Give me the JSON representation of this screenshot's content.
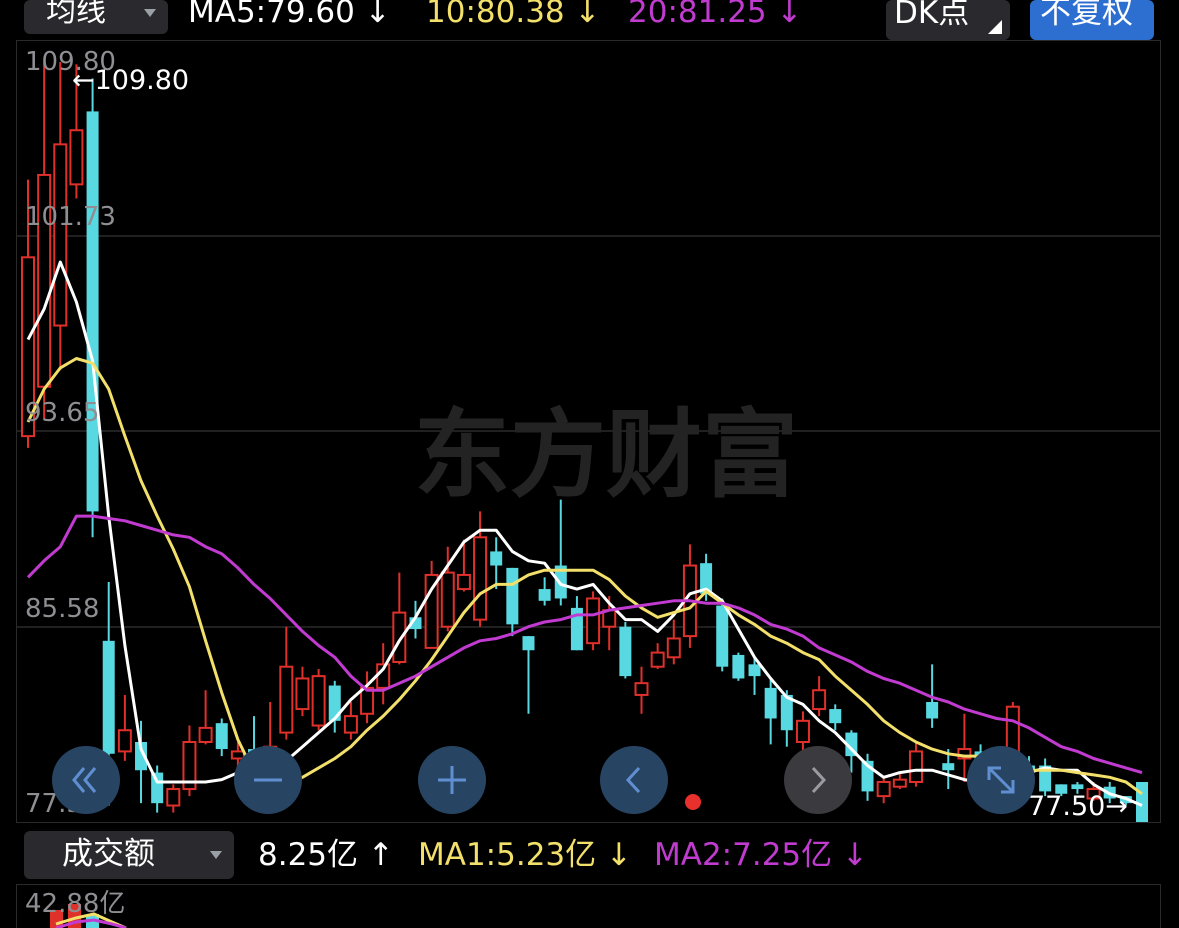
{
  "top": {
    "period_label": "均线",
    "ma5": "MA5:79.60",
    "ma10": "10:80.38",
    "ma20": "20:81.25",
    "arrow_down": "↓",
    "dk_label": "DK点",
    "fq_label": "不复权"
  },
  "y_axis": {
    "l1": "109.80",
    "l2": "101.73",
    "l3": "93.65",
    "l4": "85.58",
    "l5": "77.50"
  },
  "markers": {
    "high": "109.80",
    "low": "77.50"
  },
  "watermark": "东方财富",
  "volume": {
    "label": "成交额",
    "value": "8.25亿",
    "value_arrow": "↑",
    "ma1": "MA1:5.23亿",
    "ma1_arrow": "↓",
    "ma2": "MA2:7.25亿",
    "ma2_arrow": "↓",
    "y_top": "42.88亿"
  },
  "colors": {
    "up": "#e0302a",
    "down": "#58d8e0",
    "ma5": "#ffffff",
    "ma10": "#f2e06a",
    "ma20": "#c23bd1",
    "accent": "#2d6fd0"
  },
  "chart_data": {
    "type": "candlestick",
    "y_range": [
      77.5,
      109.8
    ],
    "series": [
      {
        "name": "MA5",
        "values": [
          98.0,
          99.3,
          101.3,
          99.6,
          97.1,
          90.5,
          85.0,
          80.6,
          79.2,
          79.2,
          79.2,
          79.2,
          79.3,
          79.6,
          79.5,
          79.6,
          80.1,
          80.7,
          81.3,
          81.9,
          82.7,
          83.3,
          84.0,
          85.2,
          86.2,
          87.4,
          88.4,
          89.4,
          89.9,
          89.9,
          89.0,
          88.6,
          88.5,
          87.6,
          87.4,
          87.6,
          86.8,
          86.1,
          86.1,
          85.6,
          86.3,
          87.2,
          87.4,
          86.9,
          85.7,
          84.5,
          83.6,
          82.8,
          82.5,
          81.8,
          81.3,
          80.6,
          79.9,
          79.4,
          79.6,
          79.7,
          79.7,
          79.5,
          79.3,
          79.2,
          79.2,
          79.1,
          79.6,
          79.8,
          79.7,
          79.7,
          79.1,
          78.7,
          78.5,
          78.2
        ]
      },
      {
        "name": "MA10",
        "values": [
          94.5,
          95.9,
          96.8,
          97.2,
          97.0,
          95.9,
          93.9,
          92.0,
          90.5,
          89.1,
          87.5,
          85.2,
          83.0,
          81.0,
          79.6,
          79.3,
          79.3,
          79.4,
          79.8,
          80.2,
          80.7,
          81.4,
          82.0,
          82.7,
          83.5,
          84.4,
          85.4,
          86.4,
          87.2,
          87.6,
          87.6,
          88.0,
          88.2,
          88.2,
          88.2,
          88.2,
          87.8,
          87.1,
          86.6,
          86.2,
          86.4,
          86.6,
          87.3,
          86.8,
          86.3,
          85.9,
          85.4,
          85.1,
          84.7,
          84.4,
          83.7,
          83.1,
          82.5,
          81.8,
          81.3,
          80.9,
          80.6,
          80.4,
          80.3,
          80.3,
          80.0,
          79.6,
          79.7,
          79.7,
          79.7,
          79.6,
          79.5,
          79.4,
          79.2,
          78.7
        ]
      },
      {
        "name": "MA20",
        "values": [
          87.9,
          88.6,
          89.2,
          90.5,
          90.5,
          90.4,
          90.3,
          90.1,
          89.9,
          89.7,
          89.6,
          89.2,
          88.9,
          88.3,
          87.6,
          87.0,
          86.3,
          85.6,
          85.0,
          84.5,
          83.7,
          83.1,
          83.1,
          83.4,
          83.7,
          84.1,
          84.5,
          84.9,
          85.2,
          85.3,
          85.5,
          85.8,
          86.0,
          86.1,
          86.3,
          86.3,
          86.5,
          86.6,
          86.7,
          86.8,
          86.9,
          86.9,
          86.8,
          86.8,
          86.6,
          86.3,
          85.9,
          85.7,
          85.4,
          84.9,
          84.6,
          84.3,
          83.9,
          83.6,
          83.4,
          83.1,
          82.8,
          82.6,
          82.3,
          82.1,
          81.9,
          81.8,
          81.5,
          81.1,
          80.7,
          80.5,
          80.2,
          80.0,
          79.8,
          79.6
        ]
      }
    ],
    "candles": [
      {
        "o": 93.9,
        "c": 101.5,
        "h": 104.8,
        "l": 93.4,
        "up": true
      },
      {
        "o": 96.0,
        "c": 105.0,
        "h": 109.8,
        "l": 94.6,
        "up": true
      },
      {
        "o": 98.6,
        "c": 106.3,
        "h": 109.8,
        "l": 96.7,
        "up": true
      },
      {
        "o": 104.6,
        "c": 106.9,
        "h": 109.7,
        "l": 104.0,
        "up": true
      },
      {
        "o": 107.7,
        "c": 90.7,
        "h": 109.1,
        "l": 89.6,
        "up": false
      },
      {
        "o": 85.2,
        "c": 80.4,
        "h": 87.7,
        "l": 78.2,
        "up": false
      },
      {
        "o": 80.5,
        "c": 81.4,
        "h": 82.9,
        "l": 80.1,
        "up": true
      },
      {
        "o": 80.9,
        "c": 79.7,
        "h": 81.8,
        "l": 78.3,
        "up": false
      },
      {
        "o": 79.6,
        "c": 78.3,
        "h": 79.9,
        "l": 77.9,
        "up": false
      },
      {
        "o": 78.2,
        "c": 78.9,
        "h": 79.1,
        "l": 77.9,
        "up": true
      },
      {
        "o": 78.9,
        "c": 80.9,
        "h": 81.6,
        "l": 78.6,
        "up": true
      },
      {
        "o": 80.9,
        "c": 81.5,
        "h": 83.1,
        "l": 80.8,
        "up": true
      },
      {
        "o": 81.7,
        "c": 80.6,
        "h": 81.9,
        "l": 80.3,
        "up": false
      },
      {
        "o": 80.2,
        "c": 80.5,
        "h": 80.9,
        "l": 79.0,
        "up": true
      },
      {
        "o": 80.6,
        "c": 80.2,
        "h": 82.0,
        "l": 80.0,
        "up": false
      },
      {
        "o": 80.2,
        "c": 80.7,
        "h": 82.6,
        "l": 79.9,
        "up": true
      },
      {
        "o": 81.3,
        "c": 84.1,
        "h": 85.8,
        "l": 81.0,
        "up": true
      },
      {
        "o": 82.3,
        "c": 83.6,
        "h": 84.1,
        "l": 82.0,
        "up": true
      },
      {
        "o": 81.6,
        "c": 83.7,
        "h": 84.0,
        "l": 81.4,
        "up": true
      },
      {
        "o": 83.3,
        "c": 81.8,
        "h": 83.5,
        "l": 81.3,
        "up": false
      },
      {
        "o": 81.3,
        "c": 82.0,
        "h": 82.6,
        "l": 81.0,
        "up": true
      },
      {
        "o": 82.1,
        "c": 83.2,
        "h": 83.9,
        "l": 81.7,
        "up": true
      },
      {
        "o": 83.2,
        "c": 84.2,
        "h": 85.1,
        "l": 82.5,
        "up": true
      },
      {
        "o": 84.3,
        "c": 86.4,
        "h": 88.1,
        "l": 84.2,
        "up": true
      },
      {
        "o": 86.2,
        "c": 85.7,
        "h": 86.9,
        "l": 85.3,
        "up": false
      },
      {
        "o": 84.9,
        "c": 88.0,
        "h": 88.6,
        "l": 84.9,
        "up": true
      },
      {
        "o": 85.8,
        "c": 88.1,
        "h": 89.2,
        "l": 85.6,
        "up": true
      },
      {
        "o": 87.4,
        "c": 88.0,
        "h": 89.5,
        "l": 87.3,
        "up": true
      },
      {
        "o": 86.1,
        "c": 89.6,
        "h": 90.7,
        "l": 85.8,
        "up": true
      },
      {
        "o": 89.0,
        "c": 88.4,
        "h": 89.6,
        "l": 87.4,
        "up": false
      },
      {
        "o": 88.3,
        "c": 85.9,
        "h": 88.3,
        "l": 85.4,
        "up": false
      },
      {
        "o": 85.4,
        "c": 84.8,
        "h": 85.4,
        "l": 82.1,
        "up": false
      },
      {
        "o": 87.4,
        "c": 86.9,
        "h": 87.9,
        "l": 86.7,
        "up": false
      },
      {
        "o": 88.4,
        "c": 87.0,
        "h": 91.2,
        "l": 86.7,
        "up": false
      },
      {
        "o": 86.6,
        "c": 84.8,
        "h": 87.1,
        "l": 84.8,
        "up": false
      },
      {
        "o": 85.1,
        "c": 87.0,
        "h": 87.3,
        "l": 84.8,
        "up": true
      },
      {
        "o": 85.8,
        "c": 86.5,
        "h": 87.1,
        "l": 84.8,
        "up": true
      },
      {
        "o": 85.8,
        "c": 83.7,
        "h": 86.0,
        "l": 83.6,
        "up": false
      },
      {
        "o": 82.9,
        "c": 83.4,
        "h": 84.1,
        "l": 82.1,
        "up": true
      },
      {
        "o": 84.1,
        "c": 84.7,
        "h": 85.1,
        "l": 84.0,
        "up": true
      },
      {
        "o": 84.5,
        "c": 85.3,
        "h": 86.1,
        "l": 84.2,
        "up": true
      },
      {
        "o": 85.4,
        "c": 88.4,
        "h": 89.3,
        "l": 84.9,
        "up": true
      },
      {
        "o": 88.5,
        "c": 87.2,
        "h": 88.9,
        "l": 86.9,
        "up": false
      },
      {
        "o": 86.7,
        "c": 84.1,
        "h": 87.0,
        "l": 83.9,
        "up": false
      },
      {
        "o": 84.6,
        "c": 83.6,
        "h": 84.7,
        "l": 83.5,
        "up": false
      },
      {
        "o": 84.2,
        "c": 83.7,
        "h": 84.5,
        "l": 82.9,
        "up": false
      },
      {
        "o": 83.2,
        "c": 81.9,
        "h": 83.6,
        "l": 80.8,
        "up": false
      },
      {
        "o": 82.9,
        "c": 81.4,
        "h": 83.1,
        "l": 80.7,
        "up": false
      },
      {
        "o": 80.9,
        "c": 81.8,
        "h": 82.2,
        "l": 80.1,
        "up": true
      },
      {
        "o": 82.3,
        "c": 83.1,
        "h": 83.7,
        "l": 82.0,
        "up": true
      },
      {
        "o": 82.3,
        "c": 81.7,
        "h": 82.5,
        "l": 81.4,
        "up": false
      },
      {
        "o": 81.3,
        "c": 80.3,
        "h": 81.4,
        "l": 79.6,
        "up": false
      },
      {
        "o": 80.1,
        "c": 78.8,
        "h": 80.4,
        "l": 78.4,
        "up": false
      },
      {
        "o": 78.6,
        "c": 79.2,
        "h": 79.4,
        "l": 78.3,
        "up": true
      },
      {
        "o": 79.0,
        "c": 79.3,
        "h": 79.6,
        "l": 78.9,
        "up": true
      },
      {
        "o": 79.2,
        "c": 80.5,
        "h": 80.9,
        "l": 79.0,
        "up": true
      },
      {
        "o": 82.6,
        "c": 81.9,
        "h": 84.2,
        "l": 81.5,
        "up": false
      },
      {
        "o": 80.0,
        "c": 79.7,
        "h": 80.6,
        "l": 78.9,
        "up": false
      },
      {
        "o": 80.2,
        "c": 80.6,
        "h": 82.1,
        "l": 79.2,
        "up": true
      },
      {
        "o": 80.5,
        "c": 79.9,
        "h": 80.8,
        "l": 79.6,
        "up": false
      },
      {
        "o": 79.3,
        "c": 79.5,
        "h": 80.4,
        "l": 78.7,
        "up": true
      },
      {
        "o": 79.2,
        "c": 82.4,
        "h": 82.6,
        "l": 79.1,
        "up": true
      },
      {
        "o": 79.9,
        "c": 79.6,
        "h": 80.3,
        "l": 79.4,
        "up": false
      },
      {
        "o": 79.9,
        "c": 78.8,
        "h": 80.2,
        "l": 78.6,
        "up": false
      },
      {
        "o": 79.1,
        "c": 78.7,
        "h": 79.1,
        "l": 78.6,
        "up": false
      },
      {
        "o": 79.1,
        "c": 78.9,
        "h": 79.2,
        "l": 78.7,
        "up": false
      },
      {
        "o": 78.5,
        "c": 78.9,
        "h": 79.2,
        "l": 78.4,
        "up": true
      },
      {
        "o": 79.0,
        "c": 78.5,
        "h": 79.2,
        "l": 78.3,
        "up": false
      },
      {
        "o": 78.6,
        "c": 78.3,
        "h": 78.6,
        "l": 78.2,
        "up": false
      },
      {
        "o": 79.2,
        "c": 77.5,
        "h": 79.2,
        "l": 77.5,
        "up": false
      }
    ]
  }
}
